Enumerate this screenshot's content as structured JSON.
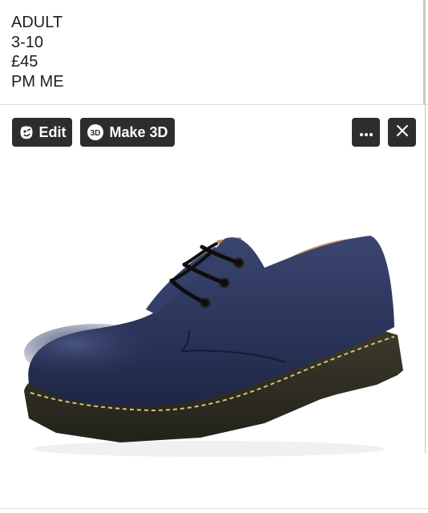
{
  "post": {
    "lines": [
      "ADULT",
      "3-10",
      "£45",
      "PM ME"
    ]
  },
  "toolbar": {
    "edit_label": "Edit",
    "make3d_label": "Make 3D",
    "make3d_badge": "3D",
    "edit_icon": "edit-face-icon",
    "more_icon": "more-dots-icon",
    "close_icon": "close-icon"
  },
  "photo": {
    "subject": "navy-leather-lace-up-shoe"
  },
  "colors": {
    "button_bg": "#2d2d2d",
    "button_text": "#ffffff",
    "text": "#1c1e21"
  }
}
